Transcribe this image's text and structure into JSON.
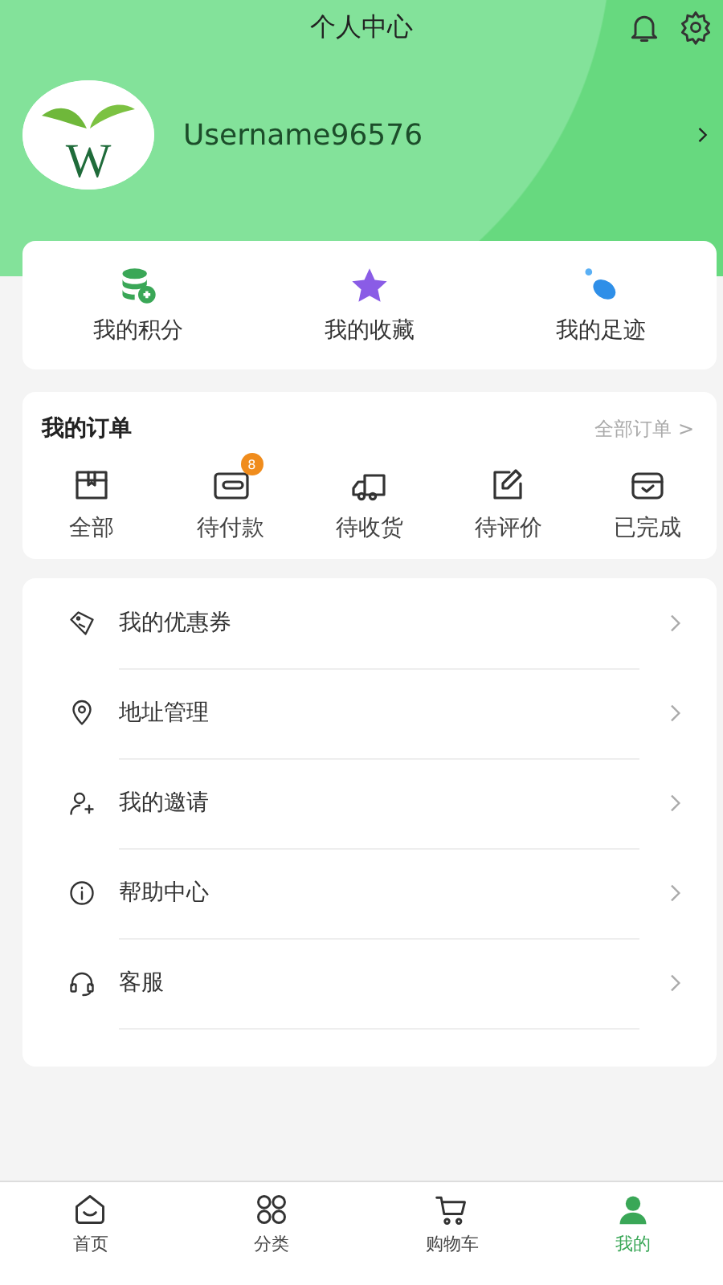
{
  "header": {
    "title": "个人中心"
  },
  "profile": {
    "username": "Username96576",
    "avatar_mark": "W"
  },
  "shortcuts": [
    {
      "label": "我的积分",
      "kind": "points"
    },
    {
      "label": "我的收藏",
      "kind": "favorites"
    },
    {
      "label": "我的足迹",
      "kind": "footprints"
    }
  ],
  "orders": {
    "title": "我的订单",
    "all_link": "全部订单 >",
    "statuses": [
      {
        "label": "全部",
        "kind": "all"
      },
      {
        "label": "待付款",
        "kind": "unpaid",
        "badge": "8"
      },
      {
        "label": "待收货",
        "kind": "shipping"
      },
      {
        "label": "待评价",
        "kind": "review"
      },
      {
        "label": "已完成",
        "kind": "done"
      }
    ]
  },
  "menu": [
    {
      "label": "我的优惠券",
      "kind": "coupon"
    },
    {
      "label": "地址管理",
      "kind": "address"
    },
    {
      "label": "我的邀请",
      "kind": "invite"
    },
    {
      "label": "帮助中心",
      "kind": "help"
    },
    {
      "label": "客服",
      "kind": "service"
    }
  ],
  "tabbar": [
    {
      "label": "首页",
      "kind": "home",
      "selected": false
    },
    {
      "label": "分类",
      "kind": "category",
      "selected": false
    },
    {
      "label": "购物车",
      "kind": "cart",
      "selected": false
    },
    {
      "label": "我的",
      "kind": "me",
      "selected": true
    }
  ]
}
